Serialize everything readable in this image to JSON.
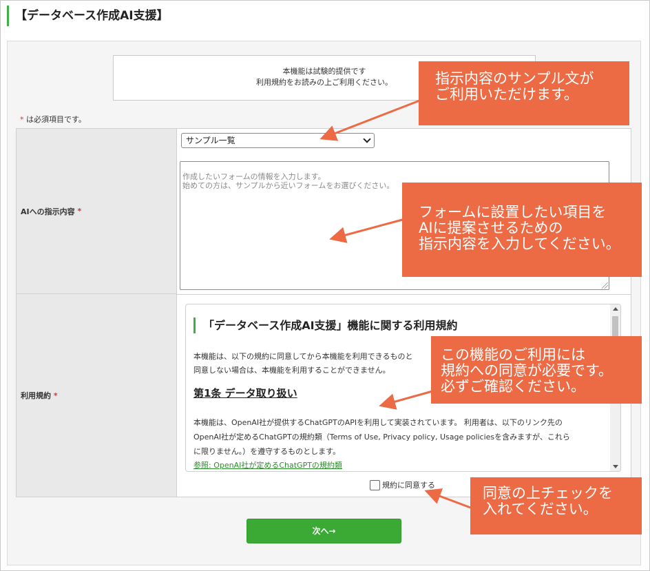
{
  "page_title": "【データベース作成AI支援】",
  "notice": {
    "line1": "本機能は試験的提供です",
    "line2": "利用規約をお読みの上ご利用ください。"
  },
  "required_note": {
    "star": "*",
    "text": " は必須項目です。"
  },
  "form": {
    "prompt_label": "AIへの指示内容",
    "terms_label": "利用規約",
    "required_star": "*",
    "sample_select_value": "サンプル一覧",
    "prompt_placeholder": "作成したいフォームの情報を入力します。\n始めての方は、サンプルから近いフォームをお選びください。"
  },
  "terms": {
    "heading": "「データベース作成AI支援」機能に関する利用規約",
    "para1_line1": "本機能は、以下の規約に同意してから本機能を利用できるものと",
    "para1_line2": "同意しない場合は、本機能を利用することができません。",
    "article1_title": "第1条 データ取り扱い",
    "para2_line1": "本機能は、OpenAI社が提供するChatGPTのAPIを利用して実装されています。 利用者は、以下のリンク先の",
    "para2_line2": "OpenAI社が定めるChatGPTの規約類（Terms of Use, Privacy policy, Usage policiesを含みますが、これら",
    "para2_line3": "に限りません。）を遵守するものとします。",
    "link_text": "参照: OpenAI社が定めるChatGPTの規約類"
  },
  "agree_label": "規約に同意する",
  "next_button": "次へ→",
  "callouts": {
    "c1": [
      "指示内容のサンプル文が",
      "ご利用いただけます。"
    ],
    "c2": [
      "フォームに設置したい項目を",
      "AIに提案させるための",
      "指示内容を入力してください。"
    ],
    "c3": [
      "この機能のご利用には",
      "規約への同意が必要です。",
      "必ずご確認ください。"
    ],
    "c4": [
      "同意の上チェックを",
      "入れてください。"
    ]
  },
  "colors": {
    "accent_green": "#3aaa35",
    "callout_orange": "#ec6a44",
    "required_red": "#e03030"
  }
}
